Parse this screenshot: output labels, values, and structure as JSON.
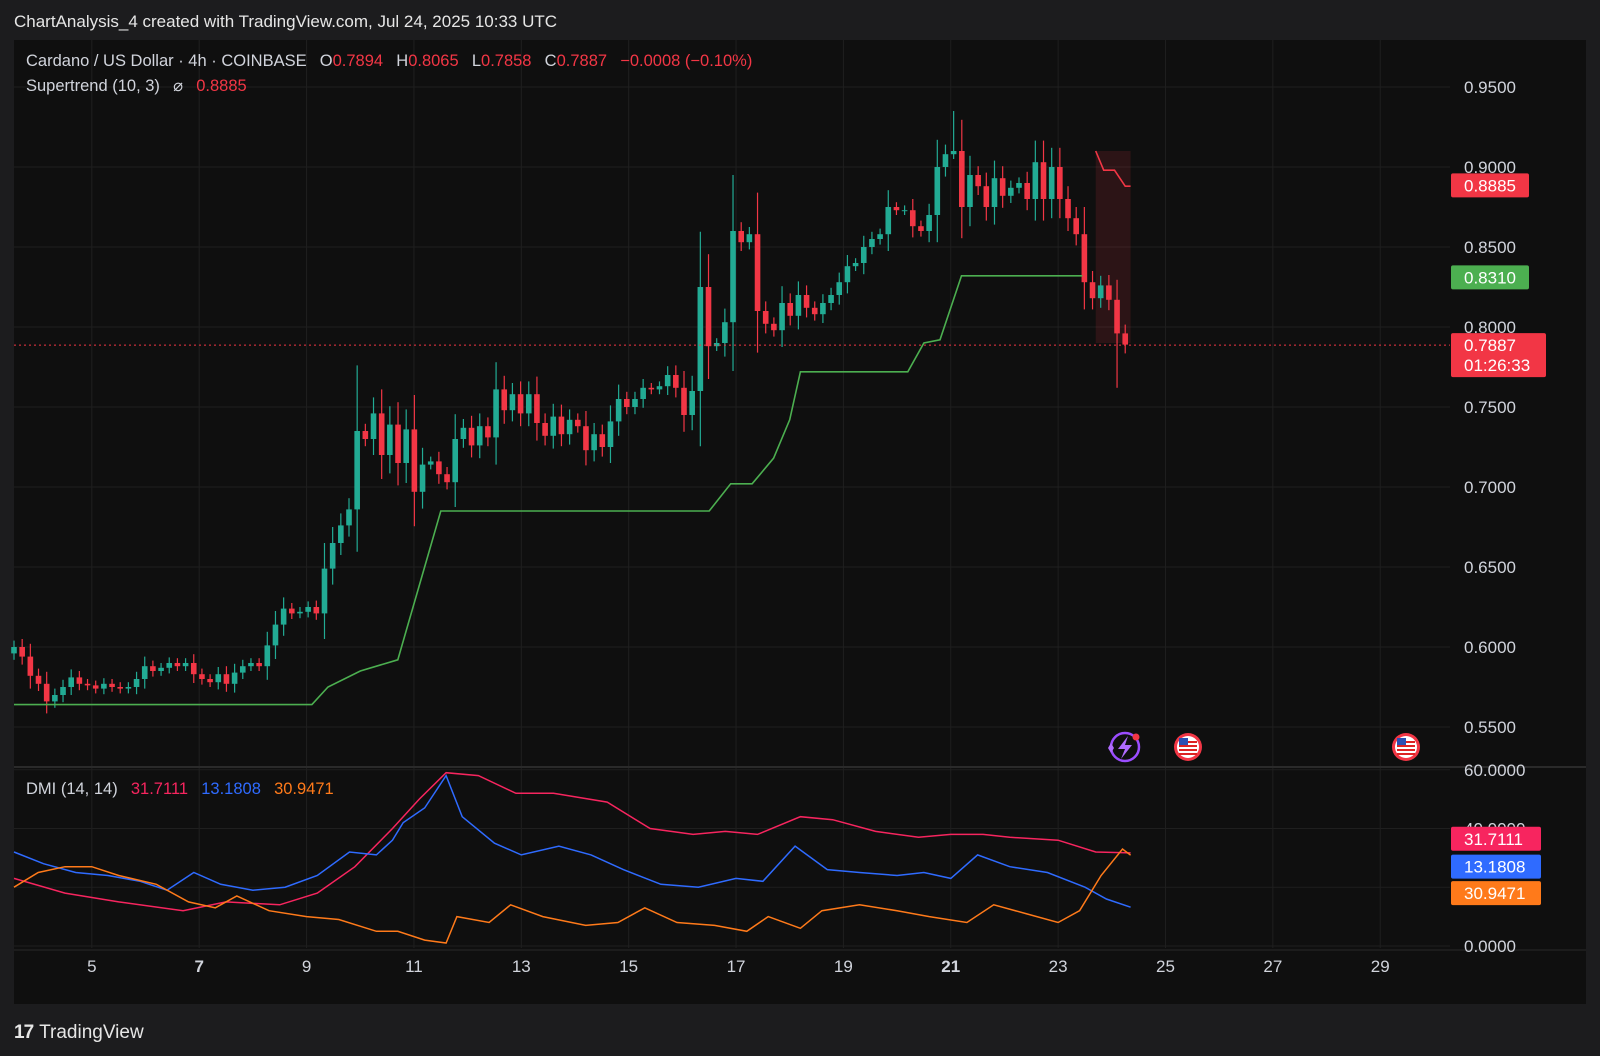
{
  "header": {
    "attribution": "ChartAnalysis_4 created with TradingView.com, Jul 24, 2025 10:33 UTC"
  },
  "legend": {
    "symbol": "Cardano / US Dollar · 4h · COINBASE",
    "o_label": "O",
    "o_value": "0.7894",
    "h_label": "H",
    "h_value": "0.8065",
    "l_label": "L",
    "l_value": "0.7858",
    "c_label": "C",
    "c_value": "0.7887",
    "change": "−0.0008 (−0.10%)",
    "supertrend_label": "Supertrend (10, 3)",
    "supertrend_icon": "⌀",
    "supertrend_value": "0.8885"
  },
  "dmi_legend": {
    "label": "DMI (14, 14)",
    "v1": "31.7111",
    "v2": "13.1808",
    "v3": "30.9471"
  },
  "footer": {
    "brand": "TradingView",
    "logo_text": "17"
  },
  "colors": {
    "up": "#22ab94",
    "down": "#f23645",
    "supertrend_up": "#4caf50",
    "supertrend_down": "#f23645",
    "adx": "#f7255f",
    "di_plus": "#2f6bff",
    "di_minus": "#ff7a1a",
    "background": "#0f0f0f",
    "grid": "#1f1f1f"
  },
  "icons": [
    "lightning-event-icon",
    "us-flag-event-icon",
    "us-flag-event-icon"
  ],
  "chart_data": [
    {
      "type": "candlestick",
      "title": "Cardano / US Dollar · 4h · COINBASE",
      "price_axis_ticks": [
        "0.9500",
        "0.9000",
        "0.8500",
        "0.8000",
        "0.7500",
        "0.7000",
        "0.6500",
        "0.6000",
        "0.5500"
      ],
      "ylim": [
        0.53,
        0.98
      ],
      "time_axis_ticks": [
        "5",
        "7",
        "9",
        "11",
        "13",
        "15",
        "17",
        "19",
        "21",
        "23",
        "25",
        "27",
        "29"
      ],
      "time_axis_bold": [
        "7",
        "21"
      ],
      "xlim_days": [
        3.55,
        30.3
      ],
      "candles_close": [
        0.6,
        0.594,
        0.582,
        0.577,
        0.566,
        0.57,
        0.575,
        0.581,
        0.577,
        0.576,
        0.574,
        0.577,
        0.575,
        0.574,
        0.575,
        0.58,
        0.588,
        0.585,
        0.587,
        0.59,
        0.588,
        0.59,
        0.583,
        0.58,
        0.578,
        0.583,
        0.577,
        0.584,
        0.588,
        0.59,
        0.588,
        0.601,
        0.614,
        0.624,
        0.621,
        0.622,
        0.625,
        0.621,
        0.649,
        0.665,
        0.676,
        0.686,
        0.735,
        0.73,
        0.746,
        0.72,
        0.739,
        0.715,
        0.736,
        0.697,
        0.714,
        0.716,
        0.708,
        0.703,
        0.73,
        0.737,
        0.726,
        0.738,
        0.731,
        0.761,
        0.748,
        0.758,
        0.746,
        0.758,
        0.74,
        0.732,
        0.744,
        0.733,
        0.742,
        0.738,
        0.723,
        0.733,
        0.725,
        0.741,
        0.755,
        0.75,
        0.755,
        0.762,
        0.761,
        0.763,
        0.77,
        0.762,
        0.745,
        0.76,
        0.825,
        0.788,
        0.79,
        0.803,
        0.86,
        0.853,
        0.858,
        0.81,
        0.802,
        0.798,
        0.815,
        0.807,
        0.82,
        0.812,
        0.808,
        0.815,
        0.82,
        0.828,
        0.838,
        0.84,
        0.85,
        0.855,
        0.858,
        0.875,
        0.873,
        0.873,
        0.863,
        0.86,
        0.87,
        0.9,
        0.908,
        0.91,
        0.875,
        0.895,
        0.888,
        0.875,
        0.893,
        0.882,
        0.887,
        0.89,
        0.88,
        0.903,
        0.88,
        0.9,
        0.88,
        0.868,
        0.858,
        0.828,
        0.818,
        0.826,
        0.817,
        0.796,
        0.789
      ],
      "candle_extremes": {
        "high": 0.935,
        "low": 0.762
      },
      "supertrend": [
        {
          "day": 3.55,
          "value": 0.564
        },
        {
          "day": 9.1,
          "value": 0.564
        },
        {
          "day": 9.4,
          "value": 0.575
        },
        {
          "day": 10.0,
          "value": 0.585
        },
        {
          "day": 10.7,
          "value": 0.592
        },
        {
          "day": 11.5,
          "value": 0.685
        },
        {
          "day": 16.5,
          "value": 0.685
        },
        {
          "day": 16.9,
          "value": 0.702
        },
        {
          "day": 17.3,
          "value": 0.702
        },
        {
          "day": 17.7,
          "value": 0.718
        },
        {
          "day": 18.0,
          "value": 0.742
        },
        {
          "day": 18.2,
          "value": 0.772
        },
        {
          "day": 19.5,
          "value": 0.772
        },
        {
          "day": 20.2,
          "value": 0.772
        },
        {
          "day": 20.5,
          "value": 0.79
        },
        {
          "day": 20.8,
          "value": 0.792
        },
        {
          "day": 21.2,
          "value": 0.832
        },
        {
          "day": 23.45,
          "value": 0.832
        }
      ],
      "supertrend_down": [
        {
          "day": 23.7,
          "value": 0.91
        },
        {
          "day": 23.85,
          "value": 0.898
        },
        {
          "day": 24.05,
          "value": 0.898
        },
        {
          "day": 24.25,
          "value": 0.888
        },
        {
          "day": 24.35,
          "value": 0.888
        }
      ],
      "current_price": 0.7887,
      "price_tags": [
        {
          "value": "0.8885",
          "color": "#f23645"
        },
        {
          "value": "0.8310",
          "color": "#4caf50"
        },
        {
          "value": "0.7887",
          "extra": "01:26:33",
          "color": "#f23645"
        }
      ]
    },
    {
      "type": "line",
      "title": "DMI (14, 14)",
      "y_ticks": [
        "60.0000",
        "40.0000",
        "0.0000"
      ],
      "ylim": [
        -0.7,
        60.6
      ],
      "series": [
        {
          "name": "31.7111",
          "color": "#f7255f",
          "points": [
            [
              3.55,
              23
            ],
            [
              4.5,
              18
            ],
            [
              5.5,
              15
            ],
            [
              6.7,
              12
            ],
            [
              7.5,
              15
            ],
            [
              8.5,
              14
            ],
            [
              9.2,
              18
            ],
            [
              9.9,
              27
            ],
            [
              10.6,
              40
            ],
            [
              11.1,
              50
            ],
            [
              11.6,
              59
            ],
            [
              12.2,
              58
            ],
            [
              12.9,
              52
            ],
            [
              13.6,
              52
            ],
            [
              14.6,
              49
            ],
            [
              15.4,
              40
            ],
            [
              16.2,
              38
            ],
            [
              16.8,
              39
            ],
            [
              17.4,
              38
            ],
            [
              18.2,
              44
            ],
            [
              18.8,
              43
            ],
            [
              19.6,
              39
            ],
            [
              20.4,
              37
            ],
            [
              21.0,
              38
            ],
            [
              21.6,
              38
            ],
            [
              22.1,
              37
            ],
            [
              23.0,
              36
            ],
            [
              23.7,
              32
            ],
            [
              24.35,
              31.7
            ]
          ]
        },
        {
          "name": "13.1808",
          "color": "#2f6bff",
          "points": [
            [
              3.55,
              32
            ],
            [
              4.1,
              28
            ],
            [
              4.7,
              25
            ],
            [
              5.3,
              24
            ],
            [
              5.9,
              22
            ],
            [
              6.4,
              19
            ],
            [
              6.9,
              25
            ],
            [
              7.4,
              21
            ],
            [
              8.0,
              19
            ],
            [
              8.6,
              20
            ],
            [
              9.2,
              24
            ],
            [
              9.8,
              32
            ],
            [
              10.3,
              31
            ],
            [
              10.6,
              36
            ],
            [
              10.8,
              42
            ],
            [
              11.2,
              47
            ],
            [
              11.6,
              58
            ],
            [
              11.9,
              44
            ],
            [
              12.5,
              35
            ],
            [
              13.0,
              31
            ],
            [
              13.7,
              34
            ],
            [
              14.3,
              31
            ],
            [
              14.9,
              26
            ],
            [
              15.6,
              21
            ],
            [
              16.3,
              20
            ],
            [
              17.0,
              23
            ],
            [
              17.5,
              22
            ],
            [
              18.1,
              34
            ],
            [
              18.7,
              26
            ],
            [
              19.3,
              25
            ],
            [
              20.0,
              24
            ],
            [
              20.5,
              25
            ],
            [
              21.0,
              23
            ],
            [
              21.5,
              31
            ],
            [
              22.1,
              27
            ],
            [
              22.8,
              25
            ],
            [
              23.5,
              20
            ],
            [
              23.9,
              16
            ],
            [
              24.35,
              13.2
            ]
          ]
        },
        {
          "name": "30.9471",
          "color": "#ff7a1a",
          "points": [
            [
              3.55,
              20
            ],
            [
              4.0,
              25
            ],
            [
              4.5,
              27
            ],
            [
              5.0,
              27
            ],
            [
              5.5,
              24
            ],
            [
              6.2,
              21
            ],
            [
              6.8,
              15
            ],
            [
              7.3,
              13
            ],
            [
              7.7,
              17
            ],
            [
              8.3,
              12
            ],
            [
              9.0,
              10
            ],
            [
              9.6,
              9
            ],
            [
              10.3,
              5
            ],
            [
              10.7,
              5
            ],
            [
              11.2,
              2
            ],
            [
              11.6,
              1
            ],
            [
              11.8,
              10
            ],
            [
              12.4,
              8
            ],
            [
              12.8,
              14
            ],
            [
              13.4,
              10
            ],
            [
              14.2,
              7
            ],
            [
              14.8,
              8
            ],
            [
              15.3,
              13
            ],
            [
              15.9,
              8
            ],
            [
              16.6,
              7
            ],
            [
              17.2,
              5
            ],
            [
              17.6,
              10
            ],
            [
              18.2,
              6
            ],
            [
              18.6,
              12
            ],
            [
              19.3,
              14
            ],
            [
              20.0,
              12
            ],
            [
              20.6,
              10
            ],
            [
              21.3,
              8
            ],
            [
              21.8,
              14
            ],
            [
              22.4,
              11
            ],
            [
              23.0,
              8
            ],
            [
              23.4,
              12
            ],
            [
              23.8,
              24
            ],
            [
              24.2,
              33
            ],
            [
              24.35,
              30.9
            ]
          ]
        }
      ]
    }
  ]
}
